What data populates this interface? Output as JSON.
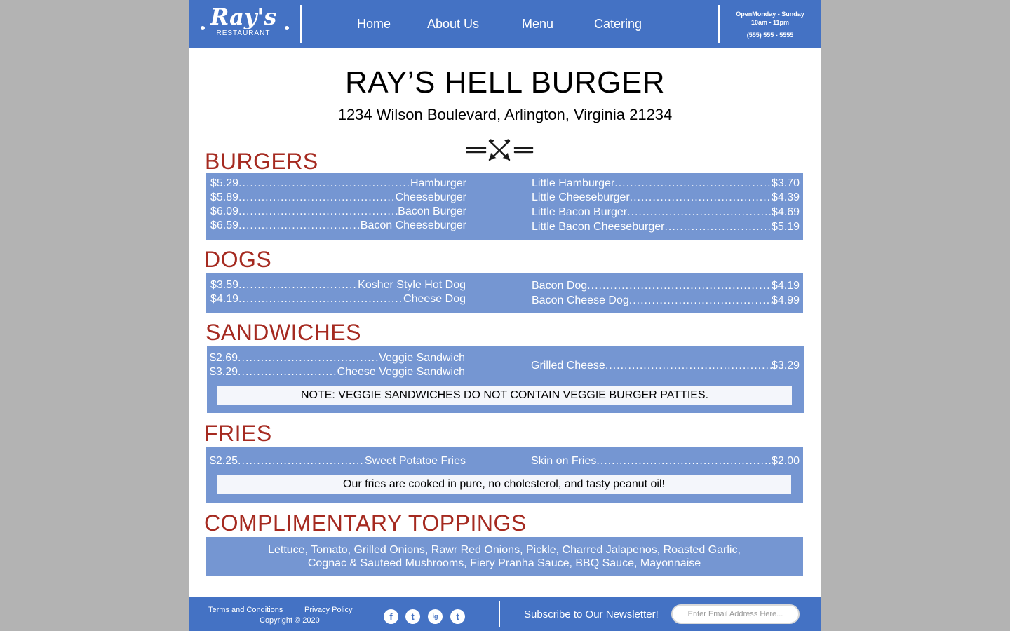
{
  "header": {
    "logo_text": "Ray's",
    "logo_sub": "RESTAURANT",
    "nav": [
      "Home",
      "About Us",
      "Menu",
      "Catering"
    ],
    "hours_line1": "OpenMonday - Sunday",
    "hours_line2": "10am - 11pm",
    "phone": "(555) 555 - 5555"
  },
  "restaurant": {
    "name": "RAY’S HELL BURGER",
    "address": "1234 Wilson Boulevard, Arlington, Virginia 21234"
  },
  "sections": {
    "burgers": {
      "title": "BURGERS",
      "left": [
        {
          "price": "$5.29",
          "name": "Hamburger"
        },
        {
          "price": "$5.89",
          "name": "Cheeseburger"
        },
        {
          "price": "$6.09",
          "name": "Bacon Burger"
        },
        {
          "price": "$6.59",
          "name": "Bacon Cheeseburger"
        }
      ],
      "right": [
        {
          "name": "Little Hamburger",
          "price": "$3.70"
        },
        {
          "name": "Little Cheeseburger",
          "price": "$4.39"
        },
        {
          "name": "Little Bacon Burger",
          "price": "$4.69"
        },
        {
          "name": "Little Bacon Cheeseburger",
          "price": "$5.19"
        }
      ]
    },
    "dogs": {
      "title": "DOGS",
      "left": [
        {
          "price": "$3.59",
          "name": "Kosher Style Hot Dog"
        },
        {
          "price": "$4.19",
          "name": "Cheese Dog"
        }
      ],
      "right": [
        {
          "name": "Bacon Dog",
          "price": "$4.19"
        },
        {
          "name": "Bacon Cheese Dog",
          "price": "$4.99"
        }
      ]
    },
    "sandwiches": {
      "title": "SANDWICHES",
      "left": [
        {
          "price": "$2.69",
          "name": "Veggie Sandwich"
        },
        {
          "price": "$3.29",
          "name": "Cheese Veggie Sandwich"
        }
      ],
      "right": [
        {
          "name": "Grilled Cheese",
          "price": "$3.29"
        }
      ],
      "note": "NOTE: VEGGIE SANDWICHES DO NOT CONTAIN VEGGIE BURGER PATTIES."
    },
    "fries": {
      "title": "FRIES",
      "left": [
        {
          "price": "$2.25",
          "name": "Sweet Potatoe Fries"
        }
      ],
      "right": [
        {
          "name": "Skin on Fries",
          "price": "$2.00"
        }
      ],
      "note": "Our fries are cooked in pure, no cholesterol, and tasty peanut oil!"
    },
    "toppings": {
      "title": "COMPLIMENTARY TOPPINGS",
      "line1": "Lettuce, Tomato, Grilled Onions, Rawr Red Onions, Pickle, Charred Jalapenos, Roasted Garlic,",
      "line2": "Cognac & Sauteed Mushrooms, Fiery Pranha Sauce, BBQ Sauce, Mayonnaise"
    }
  },
  "footer": {
    "terms": "Terms and Conditions",
    "privacy": "Privacy Policy",
    "copyright": "Copyright  © 2020",
    "social": [
      "f",
      "t",
      "ig",
      "t"
    ],
    "newsletter": "Subscribe to Our Newsletter!",
    "email_placeholder": "Enter Email Address Here..."
  },
  "colors": {
    "header_blue": "#4472c4",
    "box_blue": "#7596d2",
    "section_red": "#a52a20"
  }
}
